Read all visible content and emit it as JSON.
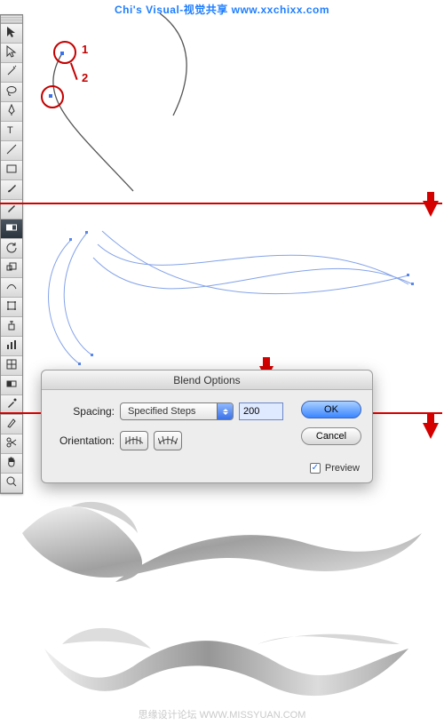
{
  "credit": "Chi's Visual-视觉共享  www.xxchixx.com",
  "annotations": {
    "a1": "1",
    "a2": "2"
  },
  "toolbox": {
    "tools": [
      "selection",
      "direct-selection",
      "magic-wand",
      "lasso",
      "pen",
      "type",
      "line",
      "rectangle",
      "paintbrush",
      "pencil",
      "blend",
      "rotate",
      "scale",
      "warp",
      "free-transform",
      "symbol-sprayer",
      "graph",
      "mesh",
      "gradient",
      "eyedropper",
      "slice",
      "scissors",
      "hand",
      "zoom"
    ],
    "selected_index": 10
  },
  "dialog": {
    "title": "Blend Options",
    "spacing_label": "Spacing:",
    "spacing_mode": "Specified Steps",
    "steps_value": "200",
    "orientation_label": "Orientation:",
    "ok": "OK",
    "cancel": "Cancel",
    "preview_label": "Preview",
    "preview_checked": true
  },
  "watermark": "思缘设计论坛  WWW.MISSYUAN.COM"
}
